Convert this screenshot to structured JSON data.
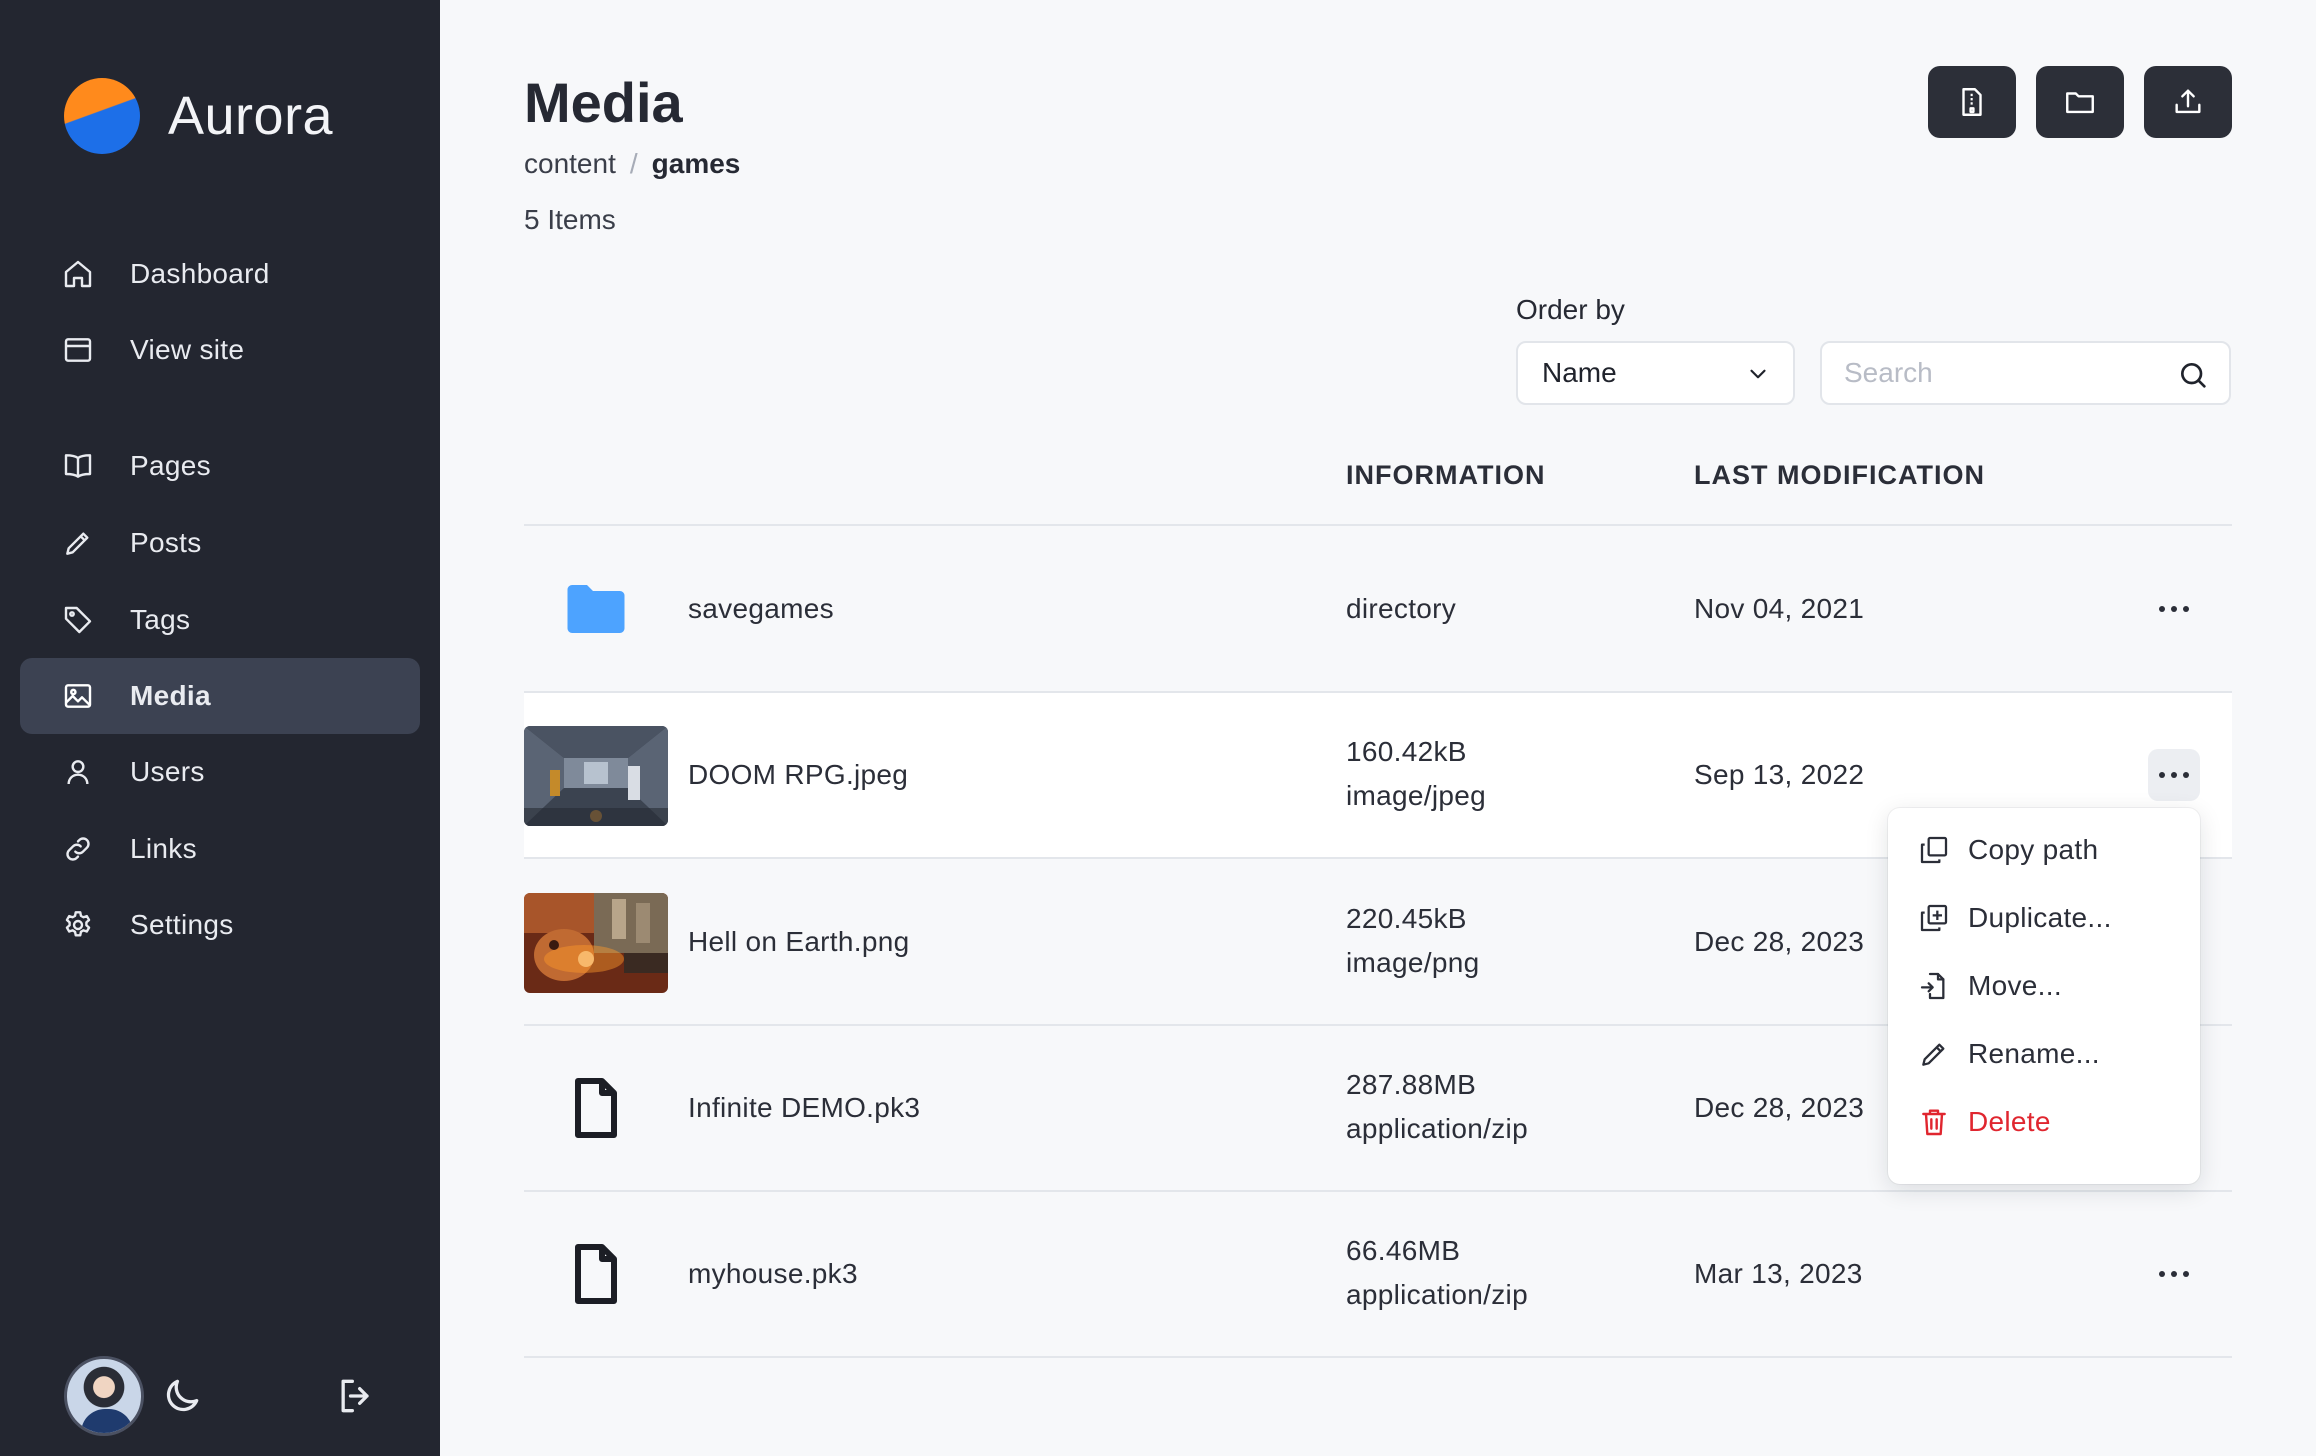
{
  "brand": {
    "name": "Aurora"
  },
  "sidebar": {
    "items": [
      {
        "label": "Dashboard",
        "icon": "home-icon"
      },
      {
        "label": "View site",
        "icon": "browser-window-icon"
      },
      {
        "label": "Pages",
        "icon": "book-open-icon"
      },
      {
        "label": "Posts",
        "icon": "pencil-icon"
      },
      {
        "label": "Tags",
        "icon": "tag-icon"
      },
      {
        "label": "Media",
        "icon": "image-icon",
        "active": true
      },
      {
        "label": "Users",
        "icon": "user-icon"
      },
      {
        "label": "Links",
        "icon": "link-icon"
      },
      {
        "label": "Settings",
        "icon": "gear-icon"
      }
    ]
  },
  "header": {
    "title": "Media",
    "breadcrumb": [
      "content",
      "games"
    ],
    "breadcrumb_sep": "/",
    "item_count": "5 Items"
  },
  "toolbar": {
    "actions": [
      "new-file-icon",
      "folder-icon",
      "upload-icon"
    ]
  },
  "filters": {
    "order_by_label": "Order by",
    "order_by_value": "Name",
    "search_placeholder": "Search"
  },
  "table": {
    "columns": [
      "INFORMATION",
      "LAST MODIFICATION"
    ],
    "rows": [
      {
        "name": "savegames",
        "info": [
          "directory"
        ],
        "modified": "Nov 04, 2021",
        "kind": "folder"
      },
      {
        "name": "DOOM RPG.jpeg",
        "info": [
          "160.42kB",
          "image/jpeg"
        ],
        "modified": "Sep 13, 2022",
        "kind": "image"
      },
      {
        "name": "Hell on Earth.png",
        "info": [
          "220.45kB",
          "image/png"
        ],
        "modified": "Dec 28, 2023",
        "kind": "image"
      },
      {
        "name": "Infinite DEMO.pk3",
        "info": [
          "287.88MB",
          "application/zip"
        ],
        "modified": "Dec 28, 2023",
        "kind": "file"
      },
      {
        "name": "myhouse.pk3",
        "info": [
          "66.46MB",
          "application/zip"
        ],
        "modified": "Mar 13, 2023",
        "kind": "file"
      }
    ]
  },
  "context_menu": {
    "items": [
      {
        "label": "Copy path",
        "icon": "copy-icon"
      },
      {
        "label": "Duplicate...",
        "icon": "duplicate-icon"
      },
      {
        "label": "Move...",
        "icon": "move-file-icon"
      },
      {
        "label": "Rename...",
        "icon": "pencil-icon"
      },
      {
        "label": "Delete",
        "icon": "trash-icon",
        "danger": true
      }
    ]
  },
  "colors": {
    "sidebar_bg": "#232630",
    "active_item_bg": "#3c4252",
    "folder_blue": "#4da3ff",
    "danger_red": "#e0262f",
    "brand_orange": "#ff8a1c",
    "brand_blue": "#1d6fe8"
  }
}
